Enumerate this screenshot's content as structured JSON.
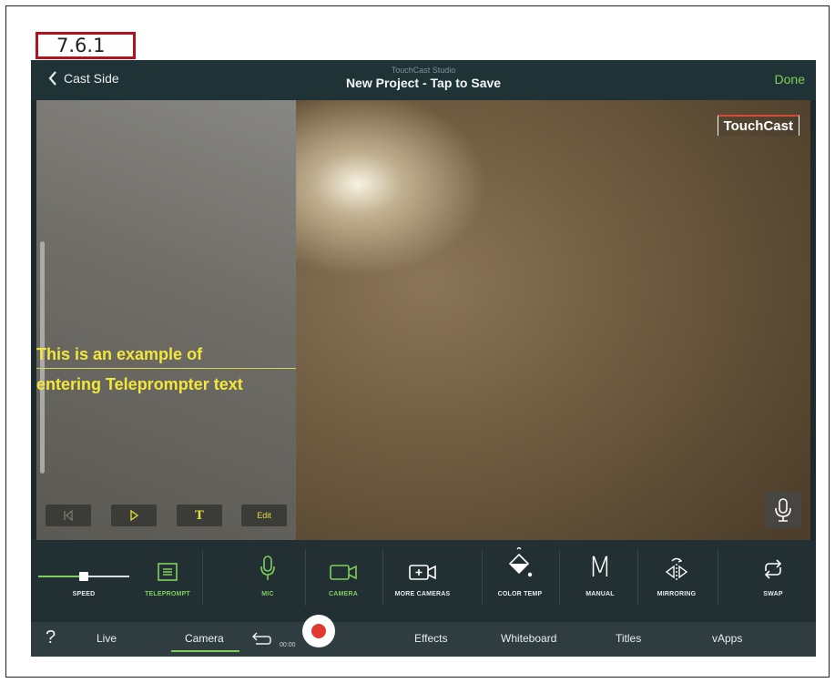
{
  "figure_label": "7.6.1",
  "header": {
    "back_label": "Cast Side",
    "studio_label": "TouchCast Studio",
    "project_title": "New Project - Tap to Save",
    "done_label": "Done"
  },
  "teleprompter": {
    "line1": "This is an example of",
    "line2": "entering Teleprompter text",
    "controls": {
      "text_label": "T",
      "edit_label": "Edit"
    }
  },
  "brand_logo": "TouchCast",
  "toolbar": {
    "speed_label": "SPEED",
    "speed_level": 0.5,
    "teleprompt_label": "TELEPROMPT",
    "mic_label": "MIC",
    "camera_label": "CAMERA",
    "more_cameras_label": "MORE CAMERAS",
    "color_temp_label": "COLOR TEMP",
    "manual_label": "MANUAL",
    "manual_glyph": "M",
    "mirroring_label": "MIRRORING",
    "swap_label": "SWAP"
  },
  "tabbar": {
    "help": "?",
    "live": "Live",
    "camera": "Camera",
    "timecode": "00:00",
    "effects": "Effects",
    "whiteboard": "Whiteboard",
    "titles": "Titles",
    "vapps": "vApps"
  },
  "colors": {
    "accent_green": "#7fcf5a",
    "teleprompter_yellow": "#f2e73a",
    "record_red": "#e03a30"
  }
}
